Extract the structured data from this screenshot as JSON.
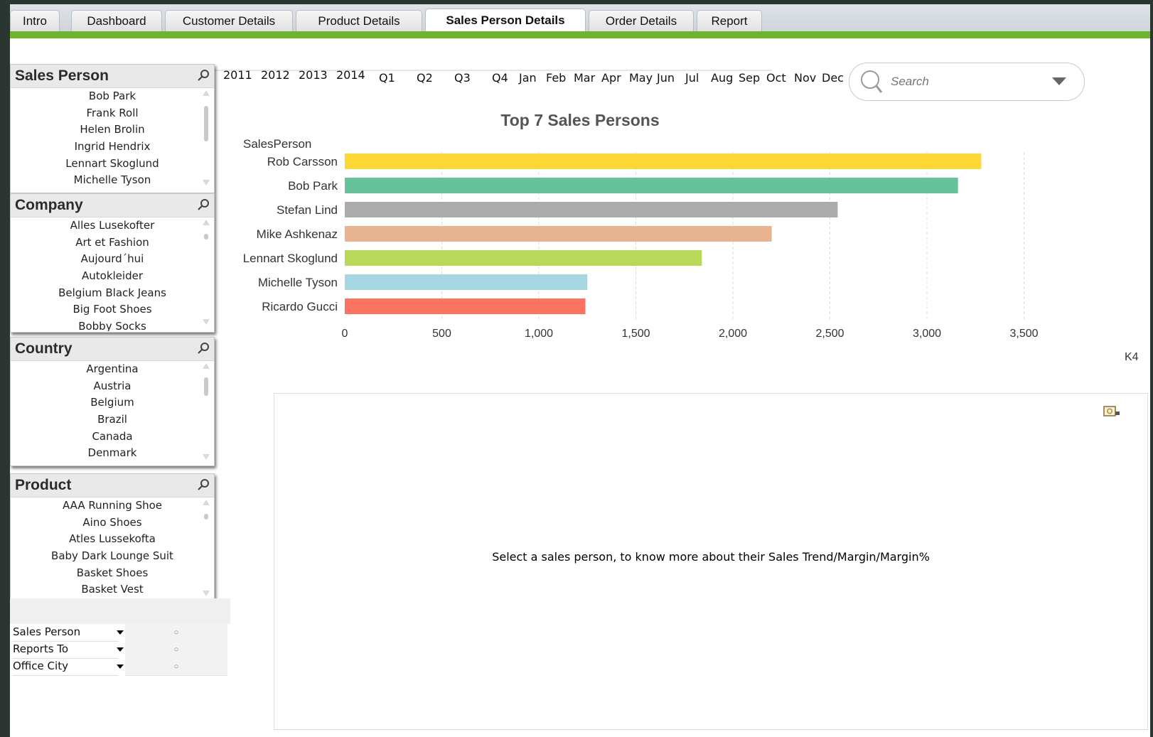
{
  "tabs": [
    {
      "label": "Intro",
      "active": false
    },
    {
      "label": "Dashboard",
      "active": false
    },
    {
      "label": "Customer Details",
      "active": false
    },
    {
      "label": "Product Details",
      "active": false
    },
    {
      "label": "Sales Person Details",
      "active": true
    },
    {
      "label": "Order Details",
      "active": false
    },
    {
      "label": "Report",
      "active": false
    }
  ],
  "listboxes": {
    "sales_person": {
      "title": "Sales Person",
      "items": [
        "Bob Park",
        "Frank Roll",
        "Helen Brolin",
        "Ingrid Hendrix",
        "Lennart Skoglund",
        "Michelle Tyson"
      ]
    },
    "company": {
      "title": "Company",
      "items": [
        "Alles Lusekofter",
        "Art et Fashion",
        "Aujourd´hui",
        "Autokleider",
        "Belgium Black Jeans",
        "Big Foot Shoes",
        "Bobby Socks"
      ]
    },
    "country": {
      "title": "Country",
      "items": [
        "Argentina",
        "Austria",
        "Belgium",
        "Brazil",
        "Canada",
        "Denmark"
      ]
    },
    "product": {
      "title": "Product",
      "items": [
        "AAA Running Shoe",
        "Aino Shoes",
        "Atles Lussekofta",
        "Baby Dark Lounge Suit",
        "Basket Shoes",
        "Basket Vest"
      ]
    }
  },
  "time_filters": {
    "years": [
      "2011",
      "2012",
      "2013",
      "2014"
    ],
    "quarters": [
      "Q1",
      "Q2",
      "Q3",
      "Q4"
    ],
    "months": [
      "Jan",
      "Feb",
      "Mar",
      "Apr",
      "May",
      "Jun",
      "Jul",
      "Aug",
      "Sep",
      "Oct",
      "Nov",
      "Dec"
    ]
  },
  "search": {
    "placeholder": "Search"
  },
  "chart_data": {
    "type": "bar",
    "orientation": "horizontal",
    "title": "Top 7 Sales Persons",
    "dimension_label": "SalesPerson",
    "unit_label": "K4",
    "categories": [
      "Rob Carsson",
      "Bob Park",
      "Stefan Lind",
      "Mike Ashkenaz",
      "Lennart Skoglund",
      "Michelle Tyson",
      "Ricardo Gucci"
    ],
    "values": [
      3280,
      3160,
      2540,
      2200,
      1840,
      1250,
      1240
    ],
    "colors": [
      "#fdd835",
      "#66c29a",
      "#ababab",
      "#e8b48f",
      "#b8d857",
      "#a7d6e3",
      "#fb7361"
    ],
    "xlim": [
      0,
      3500
    ],
    "ticks": [
      0,
      500,
      1000,
      1500,
      2000,
      2500,
      3000,
      3500
    ],
    "tick_labels": [
      "0",
      "500",
      "1,000",
      "1,500",
      "2,000",
      "2,500",
      "3,000",
      "3,500"
    ],
    "grid": true
  },
  "panel": {
    "message": "Select a sales person, to know more about their Sales Trend/Margin/Margin%"
  },
  "table_box": {
    "rows": [
      {
        "label": "Sales Person",
        "value": "○"
      },
      {
        "label": "Reports To",
        "value": "○"
      },
      {
        "label": "Office City",
        "value": "○"
      }
    ]
  }
}
